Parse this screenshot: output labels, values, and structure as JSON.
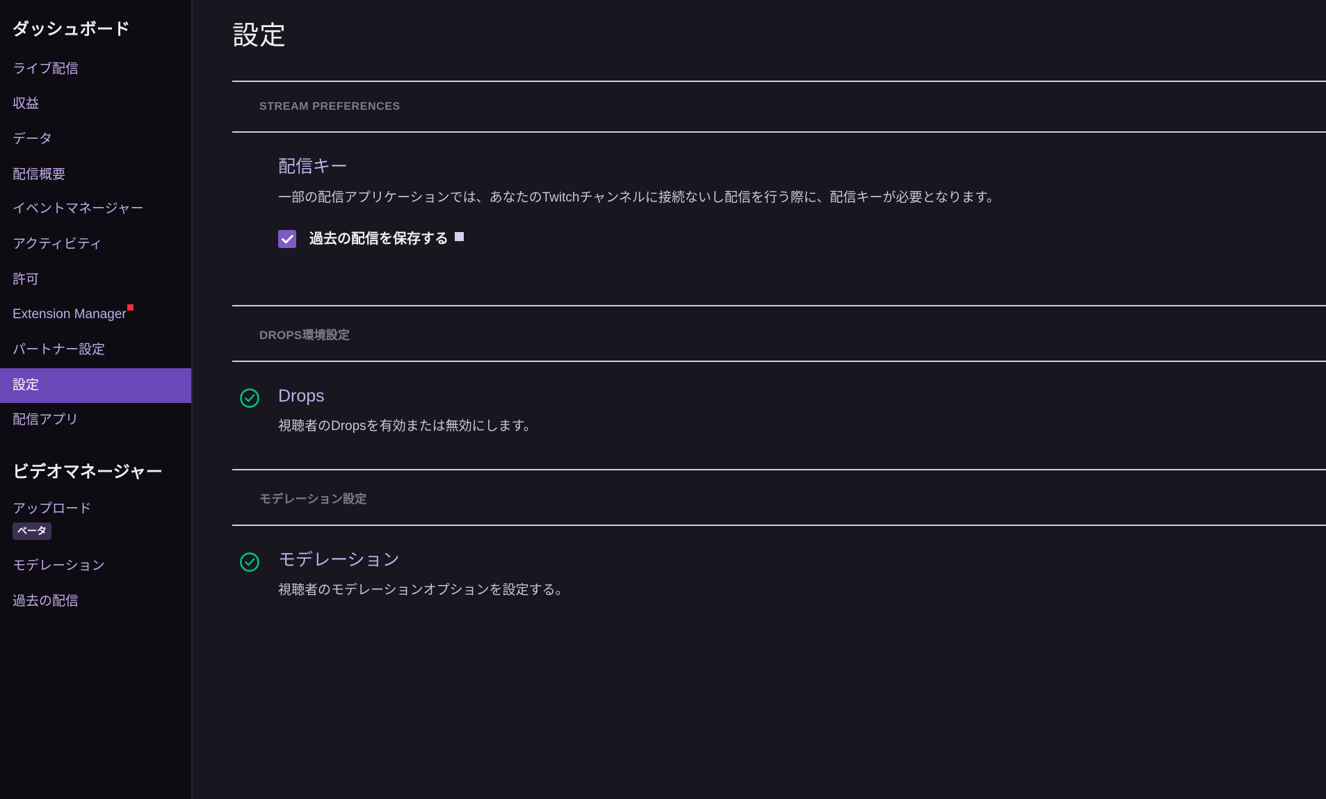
{
  "sidebar": {
    "heading_primary": "ダッシュボード",
    "heading_secondary": "ビデオマネージャー",
    "items_primary": [
      {
        "label": "ライブ配信"
      },
      {
        "label": "収益"
      },
      {
        "label": "データ"
      },
      {
        "label": "配信概要"
      },
      {
        "label": "イベントマネージャー"
      },
      {
        "label": "アクティビティ"
      },
      {
        "label": "許可"
      },
      {
        "label": "Extension Manager",
        "badge": "new-dot"
      },
      {
        "label": "パートナー設定"
      },
      {
        "label": "設定",
        "active": true
      },
      {
        "label": "配信アプリ"
      }
    ],
    "items_secondary": [
      {
        "label": "アップロード",
        "sub_badge": "ベータ"
      },
      {
        "label": "モデレーション"
      },
      {
        "label": "過去の配信"
      }
    ]
  },
  "main": {
    "page_title": "設定",
    "sections": [
      {
        "label": "STREAM PREFERENCES",
        "items": [
          {
            "title": "配信キー",
            "description": "一部の配信アプリケーションでは、あなたのTwitchチャンネルに接続ないし配信を行う際に、配信キーが必要となります。",
            "checkbox": {
              "label": "過去の配信を保存する",
              "checked": true,
              "help_icon": "info-square-icon"
            }
          }
        ]
      },
      {
        "label": "DROPS環境設定",
        "items": [
          {
            "status_icon": "check-circle-icon",
            "title": "Drops",
            "description": "視聴者のDropsを有効または無効にします。"
          }
        ]
      },
      {
        "label": "モデレーション設定",
        "items": [
          {
            "status_icon": "check-circle-icon",
            "title": "モデレーション",
            "description": "視聴者のモデレーションオプションを設定する。"
          }
        ]
      }
    ]
  },
  "colors": {
    "sidebar_bg": "#0e0c12",
    "content_bg": "#18161f",
    "accent_purple": "#6c49b8",
    "link_purple": "#bfaeea",
    "status_green": "#00c07a",
    "badge_red": "#f2303d",
    "divider": "#d3d0db",
    "section_label": "#7e7c8a"
  }
}
